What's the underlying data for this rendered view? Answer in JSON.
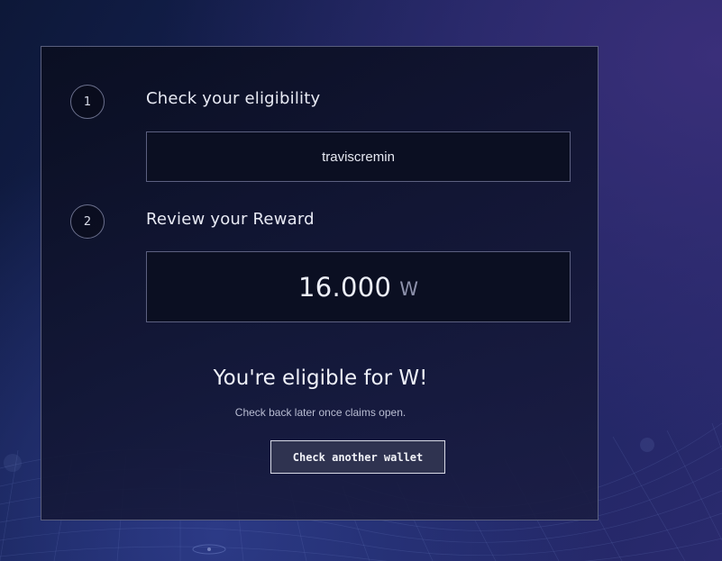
{
  "colors": {
    "background_start": "#0d1838",
    "background_end": "#2a2a6e",
    "card_border": "#5a5f7e",
    "field_background": "#0b0f22",
    "button_background": "#2f3350",
    "button_border": "#d8dae6",
    "unit_text": "#8d91ab"
  },
  "steps": [
    {
      "number": "1",
      "title": "Check your eligibility"
    },
    {
      "number": "2",
      "title": "Review your Reward"
    }
  ],
  "wallet": {
    "value": "traviscremin"
  },
  "reward": {
    "amount": "16.000",
    "unit": "W"
  },
  "result": {
    "title": "You're eligible for W!",
    "subtitle": "Check back later once claims open."
  },
  "actions": {
    "check_another_label": "Check another wallet"
  }
}
